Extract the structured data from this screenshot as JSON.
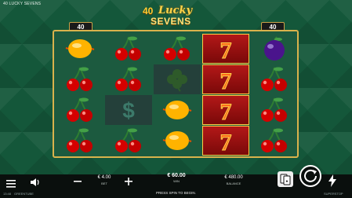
{
  "window": {
    "title": "40 LUCKY SEVENS"
  },
  "logo": {
    "prefix": "40",
    "line1": "Lucky",
    "line2": "SEVENS"
  },
  "ways_left": "40",
  "ways_right": "40",
  "reels": [
    [
      "lemon",
      "cherry",
      "cherry",
      "cherry"
    ],
    [
      "cherry",
      "cherry",
      "dollar",
      "cherry"
    ],
    [
      "cherry",
      "clover",
      "lemon",
      "lemon"
    ],
    [
      "seven",
      "seven",
      "seven",
      "seven"
    ],
    [
      "plum",
      "cherry",
      "cherry",
      "cherry"
    ]
  ],
  "bottom_bar": {
    "bet": {
      "value": "€ 4.00",
      "label": "BET"
    },
    "win": {
      "value": "€ 60.00",
      "label": "WIN"
    },
    "balance": {
      "value": "€ 480.00",
      "label": "BALANCE"
    },
    "status_text": "PRESS SPIN TO BEGIN.",
    "time": "13:48",
    "brand": "GREENTUBE",
    "turbo_label": "SUPERSTOP"
  },
  "colors": {
    "background": "#14573a",
    "frame_gold": "#d9b24c",
    "seven_red": "#b31818"
  }
}
